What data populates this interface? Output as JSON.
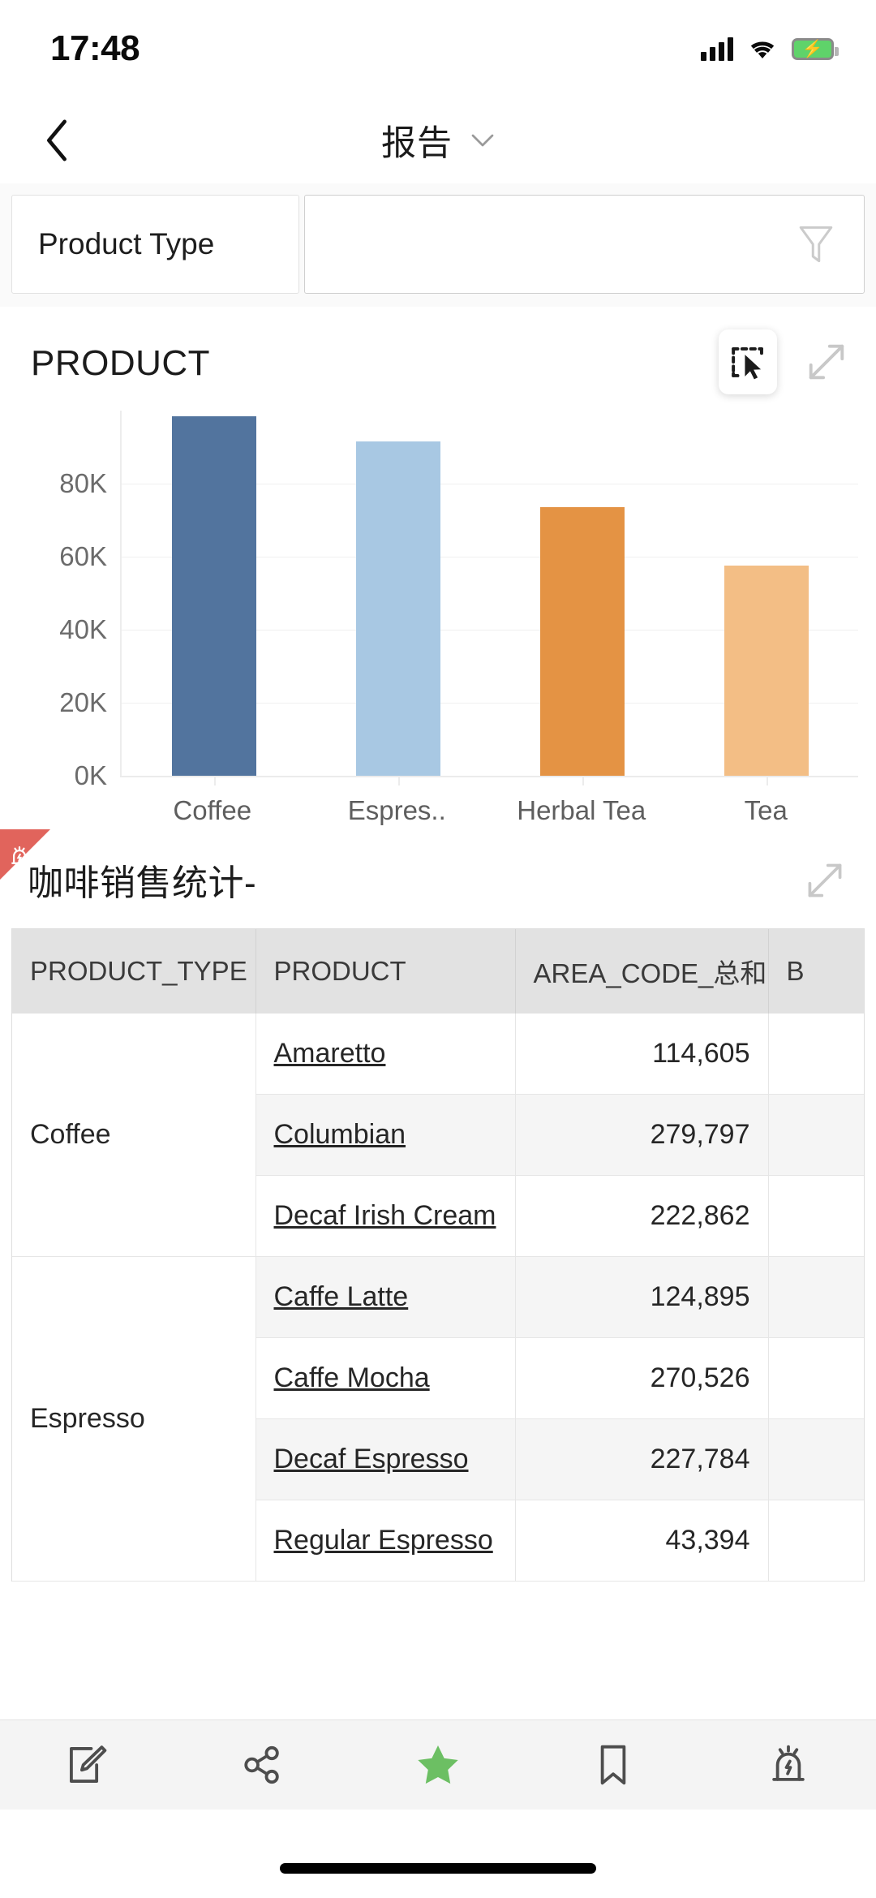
{
  "status_bar": {
    "time": "17:48",
    "signal_icon": "cellular-signal-icon",
    "wifi_icon": "wifi-icon",
    "battery_icon": "battery-charging-icon"
  },
  "nav_bar": {
    "back_icon": "chevron-left-icon",
    "title": "报告",
    "dropdown_icon": "chevron-down-icon"
  },
  "filter": {
    "label": "Product Type",
    "value": "",
    "placeholder": "",
    "filter_icon": "funnel-icon"
  },
  "chart_card": {
    "title": "PRODUCT",
    "lasso_icon": "lasso-select-icon",
    "expand_icon": "expand-diagonal-icon"
  },
  "chart_data": {
    "type": "bar",
    "title": "PRODUCT",
    "xlabel": "",
    "ylabel": "",
    "categories": [
      "Coffee",
      "Espres..",
      "Herbal Tea",
      "Tea"
    ],
    "values": [
      98400,
      91500,
      73500,
      57500
    ],
    "colors": [
      "#52749E",
      "#A8C8E3",
      "#E49344",
      "#F3BE85"
    ],
    "ylim": [
      0,
      100000
    ],
    "yticks": [
      0,
      20000,
      40000,
      60000,
      80000
    ],
    "ytick_labels": [
      "0K",
      "20K",
      "40K",
      "60K",
      "80K"
    ],
    "grid": true,
    "legend": "none"
  },
  "table_card": {
    "title": "咖啡销售统计-",
    "ribbon_icon": "alarm-alert-icon",
    "expand_icon": "expand-diagonal-icon",
    "columns": [
      "PRODUCT_TYPE",
      "PRODUCT",
      "AREA_CODE_总和",
      "B"
    ],
    "rows": [
      {
        "product_type": "",
        "product": "Amaretto",
        "area_code_sum": "114,605",
        "extra": "",
        "group_start": true,
        "group_label": "Coffee",
        "group_rows": 3,
        "alt": false
      },
      {
        "product_type": "",
        "product": "Columbian",
        "area_code_sum": "279,797",
        "extra": "",
        "alt": true
      },
      {
        "product_type": "",
        "product": "Decaf Irish Cream",
        "area_code_sum": "222,862",
        "extra": "",
        "alt": false
      },
      {
        "product_type": "",
        "product": "Caffe Latte",
        "area_code_sum": "124,895",
        "extra": "",
        "group_start": true,
        "group_label": "Espresso",
        "group_rows": 4,
        "alt": true
      },
      {
        "product_type": "",
        "product": "Caffe Mocha",
        "area_code_sum": "270,526",
        "extra": "",
        "alt": false
      },
      {
        "product_type": "",
        "product": "Decaf Espresso",
        "area_code_sum": "227,784",
        "extra": "",
        "alt": true
      },
      {
        "product_type": "",
        "product": "Regular Espresso",
        "area_code_sum": "43,394",
        "extra": "",
        "alt": false
      }
    ]
  },
  "tab_bar": {
    "items": [
      {
        "name": "annotate-tab",
        "icon": "edit-note-icon",
        "active": false
      },
      {
        "name": "share-tab",
        "icon": "share-nodes-icon",
        "active": false
      },
      {
        "name": "favorite-tab",
        "icon": "star-icon",
        "active": true
      },
      {
        "name": "bookmark-tab",
        "icon": "bookmark-icon",
        "active": false
      },
      {
        "name": "alert-tab",
        "icon": "alarm-alert-icon",
        "active": false
      }
    ],
    "active_color": "#6CBF63",
    "inactive_color": "#4d4d4d"
  }
}
